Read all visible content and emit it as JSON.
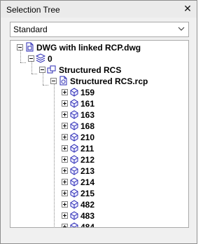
{
  "window": {
    "title": "Selection Tree",
    "close_label": "✕"
  },
  "dropdown": {
    "value": "Standard"
  },
  "tree": {
    "root_file": "DWG with linked RCP.dwg",
    "layer": "0",
    "group": "Structured RCS",
    "rcp_file": "Structured RCS.rcp",
    "scans": [
      "159",
      "161",
      "163",
      "168",
      "210",
      "211",
      "212",
      "213",
      "214",
      "215",
      "482",
      "483",
      "484"
    ]
  },
  "colors": {
    "panel_bg": "#f0f0f0",
    "title_bg": "#ebebeb",
    "icon_blue": "#2b2bb4"
  }
}
